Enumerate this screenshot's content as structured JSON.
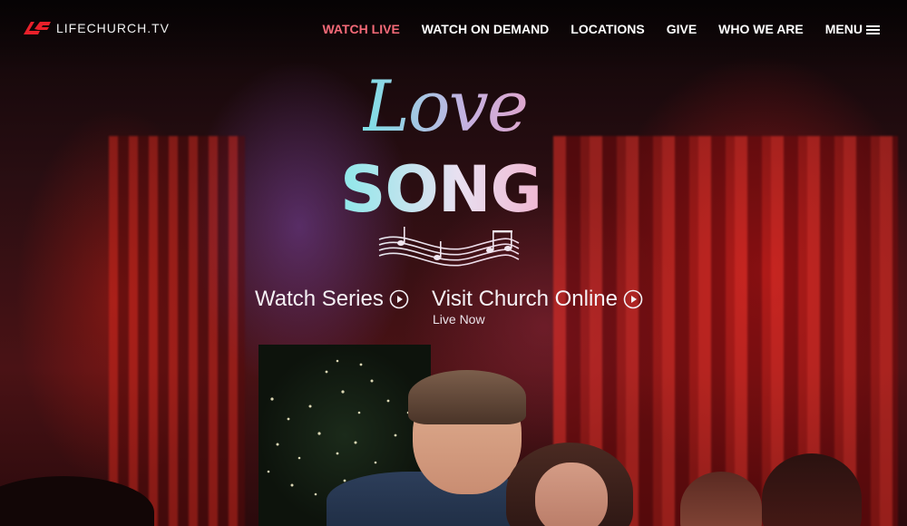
{
  "brand": {
    "name": "LIFECHURCH.TV",
    "logo_icon": "lifechurch-logo-icon"
  },
  "nav": {
    "items": [
      {
        "label": "WATCH LIVE",
        "active": true
      },
      {
        "label": "WATCH ON DEMAND",
        "active": false
      },
      {
        "label": "LOCATIONS",
        "active": false
      },
      {
        "label": "GIVE",
        "active": false
      },
      {
        "label": "WHO WE ARE",
        "active": false
      }
    ],
    "menu_label": "MENU",
    "menu_icon": "hamburger-menu-icon"
  },
  "hero": {
    "title_line1": "Love",
    "title_line2": "SONG",
    "staff_icon": "music-staff-icon",
    "actions": [
      {
        "label": "Watch Series",
        "icon": "play-circle-icon"
      },
      {
        "label": "Visit Church Online",
        "icon": "play-circle-icon",
        "sublabel": "Live Now"
      }
    ]
  },
  "colors": {
    "active_nav": "#f46a78",
    "title_gradient_start": "#7ee0e6",
    "title_gradient_end": "#f4a6c6",
    "text": "#ffffff"
  }
}
